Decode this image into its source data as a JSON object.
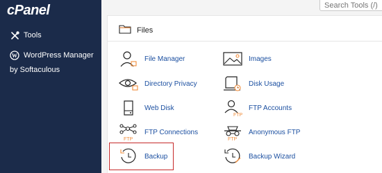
{
  "brand": {
    "logo_text": "cPanel"
  },
  "sidebar": {
    "items": [
      {
        "label": "Tools",
        "icon": "tools-icon"
      },
      {
        "label": "WordPress Manager",
        "sub": "by Softaculous",
        "icon": "wordpress-icon"
      }
    ]
  },
  "search": {
    "placeholder": "Search Tools (/)"
  },
  "files": {
    "title": "Files",
    "items": [
      {
        "label": "File Manager",
        "icon": "file-manager-icon"
      },
      {
        "label": "Images",
        "icon": "images-icon"
      },
      {
        "label": "Directory Privacy",
        "icon": "directory-privacy-icon"
      },
      {
        "label": "Disk Usage",
        "icon": "disk-usage-icon"
      },
      {
        "label": "Web Disk",
        "icon": "web-disk-icon"
      },
      {
        "label": "FTP Accounts",
        "icon": "ftp-accounts-icon"
      },
      {
        "label": "FTP Connections",
        "icon": "ftp-connections-icon"
      },
      {
        "label": "Anonymous FTP",
        "icon": "anonymous-ftp-icon"
      },
      {
        "label": "Backup",
        "icon": "backup-icon"
      },
      {
        "label": "Backup Wizard",
        "icon": "backup-wizard-icon"
      }
    ]
  },
  "colors": {
    "sidebar": "#1b2b4a",
    "link": "#1b4fa0",
    "accent": "#f08c3a",
    "highlight": "#c62828"
  }
}
